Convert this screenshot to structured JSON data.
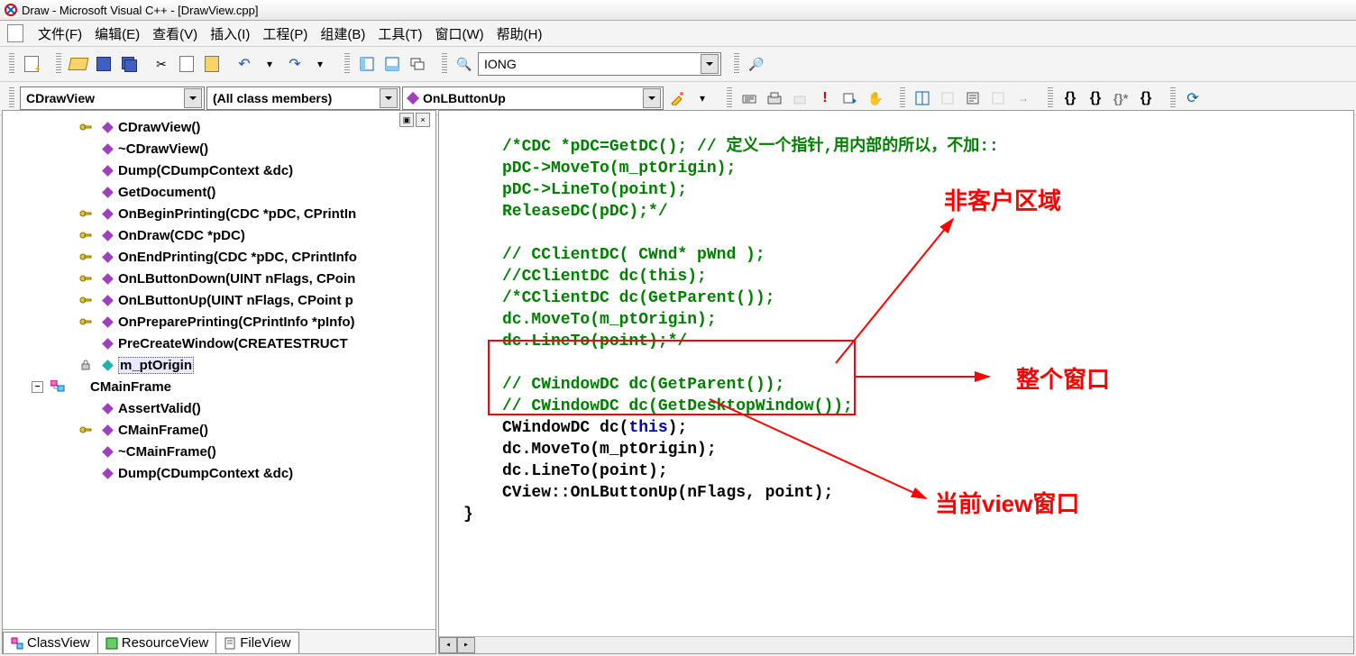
{
  "title": "Draw - Microsoft Visual C++ - [DrawView.cpp]",
  "menu": {
    "file": "文件(F)",
    "edit": "编辑(E)",
    "view": "查看(V)",
    "insert": "插入(I)",
    "project": "工程(P)",
    "build": "组建(B)",
    "tools": "工具(T)",
    "window": "窗口(W)",
    "help": "帮助(H)"
  },
  "toolbar": {
    "find_text": "IONG"
  },
  "wizbar": {
    "class_combo": "CDrawView",
    "filter_combo": "(All class members)",
    "member_combo": "OnLButtonUp"
  },
  "tree": [
    {
      "k": "key",
      "d": "purple",
      "label": "CDrawView()"
    },
    {
      "k": "",
      "d": "purple",
      "label": "~CDrawView()"
    },
    {
      "k": "",
      "d": "purple",
      "label": "Dump(CDumpContext &dc)"
    },
    {
      "k": "",
      "d": "purple",
      "label": "GetDocument()"
    },
    {
      "k": "key",
      "d": "purple",
      "label": "OnBeginPrinting(CDC *pDC, CPrintIn"
    },
    {
      "k": "key",
      "d": "purple",
      "label": "OnDraw(CDC *pDC)"
    },
    {
      "k": "key",
      "d": "purple",
      "label": "OnEndPrinting(CDC *pDC, CPrintInfo"
    },
    {
      "k": "key",
      "d": "purple",
      "label": "OnLButtonDown(UINT nFlags, CPoin"
    },
    {
      "k": "key",
      "d": "purple",
      "label": "OnLButtonUp(UINT nFlags, CPoint p"
    },
    {
      "k": "key",
      "d": "purple",
      "label": "OnPreparePrinting(CPrintInfo *pInfo)"
    },
    {
      "k": "",
      "d": "purple",
      "label": "PreCreateWindow(CREATESTRUCT"
    },
    {
      "k": "lock",
      "d": "teal",
      "label": "m_ptOrigin",
      "sel": true
    },
    {
      "k": "cls",
      "d": "",
      "label": "CMainFrame",
      "exp": true
    },
    {
      "k": "",
      "d": "purple",
      "label": "AssertValid()"
    },
    {
      "k": "key",
      "d": "purple",
      "label": "CMainFrame()"
    },
    {
      "k": "",
      "d": "purple",
      "label": "~CMainFrame()"
    },
    {
      "k": "",
      "d": "purple",
      "label": "Dump(CDumpContext &dc)"
    }
  ],
  "tabs": {
    "class": "ClassView",
    "resource": "ResourceView",
    "file": "FileView"
  },
  "code": {
    "l1": "/*CDC *pDC=GetDC(); // 定义一个指针,用内部的所以，不加::",
    "l2": "pDC->MoveTo(m_ptOrigin);",
    "l3": "pDC->LineTo(point);",
    "l4": "ReleaseDC(pDC);*/",
    "l5": "// CClientDC( CWnd* pWnd );",
    "l6": "//CClientDC dc(this);",
    "l7": "/*CClientDC dc(GetParent());",
    "l8": "dc.MoveTo(m_ptOrigin);",
    "l9": "dc.LineTo(point);*/",
    "l10": "// CWindowDC dc(GetParent());",
    "l11": "// CWindowDC dc(GetDesktopWindow());",
    "l12a": "CWindowDC dc(",
    "l12b": "this",
    "l12c": ");",
    "l13": "dc.MoveTo(m_ptOrigin);",
    "l14": "dc.LineTo(point);",
    "l15": "CView::OnLButtonUp(nFlags, point);",
    "l16": "}"
  },
  "annots": {
    "a1": "非客户区域",
    "a2": "整个窗口",
    "a3": "当前view窗口"
  }
}
